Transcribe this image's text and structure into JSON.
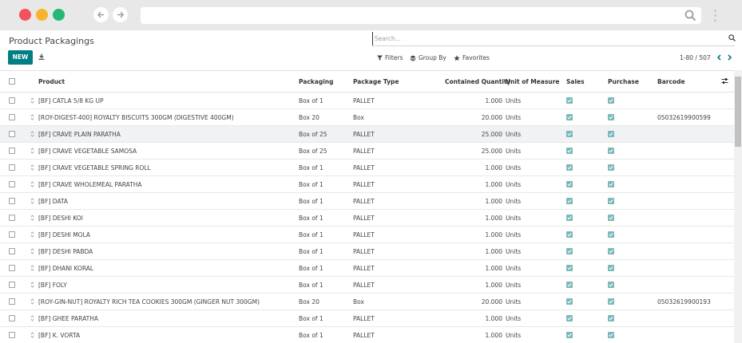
{
  "page": {
    "title": "Product Packagings",
    "search_placeholder": "Search...",
    "new_label": "NEW",
    "filters_label": "Filters",
    "groupby_label": "Group By",
    "favorites_label": "Favorites",
    "pager": "1-80 / 507",
    "accent_color": "#017e84"
  },
  "columns": {
    "product": "Product",
    "packaging": "Packaging",
    "package_type": "Package Type",
    "contained_quantity": "Contained Quantity",
    "unit_of_measure": "Unit of Measure",
    "sales": "Sales",
    "purchase": "Purchase",
    "barcode": "Barcode"
  },
  "rows": [
    {
      "product": "[BF] CATLA 5/8 KG UP",
      "packaging": "Box of 1",
      "package_type": "PALLET",
      "qty": "1.000",
      "uom": "Units",
      "sales": true,
      "purchase": true,
      "barcode": ""
    },
    {
      "product": "[ROY-DIGEST-400] ROYALTY BISCUITS 300GM (DIGESTIVE 400GM)",
      "packaging": "Box 20",
      "package_type": "Box",
      "qty": "20.000",
      "uom": "Units",
      "sales": true,
      "purchase": true,
      "barcode": "05032619900599"
    },
    {
      "product": "[BF] CRAVE PLAIN PARATHA",
      "packaging": "Box of 25",
      "package_type": "PALLET",
      "qty": "25.000",
      "uom": "Units",
      "sales": true,
      "purchase": true,
      "barcode": ""
    },
    {
      "product": "[BF] CRAVE VEGETABLE SAMOSA",
      "packaging": "Box of 25",
      "package_type": "PALLET",
      "qty": "25.000",
      "uom": "Units",
      "sales": true,
      "purchase": true,
      "barcode": ""
    },
    {
      "product": "[BF] CRAVE VEGETABLE SPRING ROLL",
      "packaging": "Box of 1",
      "package_type": "PALLET",
      "qty": "1.000",
      "uom": "Units",
      "sales": true,
      "purchase": true,
      "barcode": ""
    },
    {
      "product": "[BF] CRAVE WHOLEMEAL PARATHA",
      "packaging": "Box of 1",
      "package_type": "PALLET",
      "qty": "1.000",
      "uom": "Units",
      "sales": true,
      "purchase": true,
      "barcode": ""
    },
    {
      "product": "[BF] DATA",
      "packaging": "Box of 1",
      "package_type": "PALLET",
      "qty": "1.000",
      "uom": "Units",
      "sales": true,
      "purchase": true,
      "barcode": ""
    },
    {
      "product": "[BF] DESHI KOI",
      "packaging": "Box of 1",
      "package_type": "PALLET",
      "qty": "1.000",
      "uom": "Units",
      "sales": true,
      "purchase": true,
      "barcode": ""
    },
    {
      "product": "[BF] DESHI MOLA",
      "packaging": "Box of 1",
      "package_type": "PALLET",
      "qty": "1.000",
      "uom": "Units",
      "sales": true,
      "purchase": true,
      "barcode": ""
    },
    {
      "product": "[BF] DESHI PABDA",
      "packaging": "Box of 1",
      "package_type": "PALLET",
      "qty": "1.000",
      "uom": "Units",
      "sales": true,
      "purchase": true,
      "barcode": ""
    },
    {
      "product": "[BF] DHANI KORAL",
      "packaging": "Box of 1",
      "package_type": "PALLET",
      "qty": "1.000",
      "uom": "Units",
      "sales": true,
      "purchase": true,
      "barcode": ""
    },
    {
      "product": "[BF] FOLY",
      "packaging": "Box of 1",
      "package_type": "PALLET",
      "qty": "1.000",
      "uom": "Units",
      "sales": true,
      "purchase": true,
      "barcode": ""
    },
    {
      "product": "[ROY-GIN-NUT] ROYALTY RICH TEA COOKIES 300GM (GINGER NUT 300GM)",
      "packaging": "Box 20",
      "package_type": "Box",
      "qty": "20.000",
      "uom": "Units",
      "sales": true,
      "purchase": true,
      "barcode": "05032619900193"
    },
    {
      "product": "[BF] GHEE PARATHA",
      "packaging": "Box of 1",
      "package_type": "PALLET",
      "qty": "1.000",
      "uom": "Units",
      "sales": true,
      "purchase": true,
      "barcode": ""
    },
    {
      "product": "[BF] K. VORTA",
      "packaging": "Box of 1",
      "package_type": "PALLET",
      "qty": "1.000",
      "uom": "Units",
      "sales": true,
      "purchase": true,
      "barcode": ""
    }
  ]
}
